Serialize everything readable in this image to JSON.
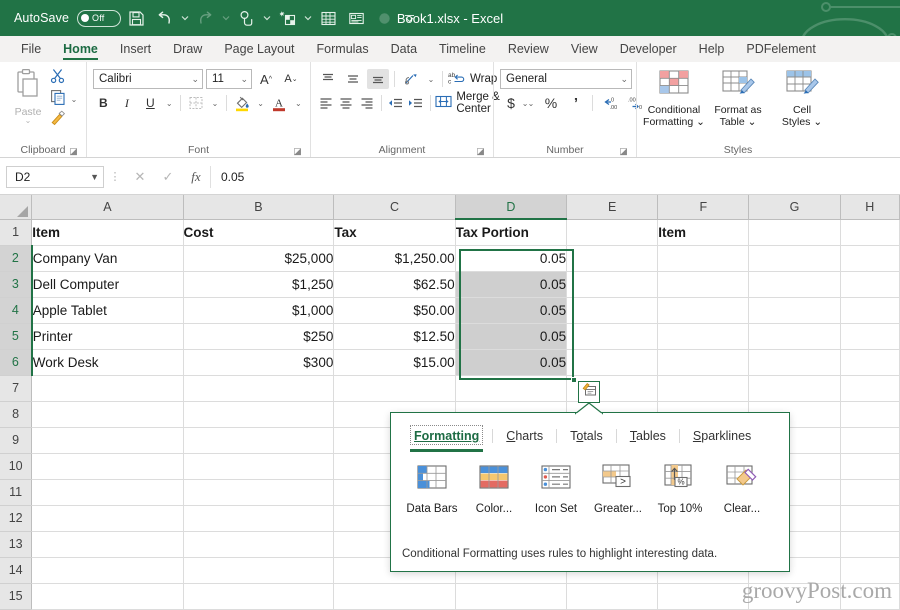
{
  "titlebar": {
    "autosave_label": "AutoSave",
    "autosave_state": "Off",
    "document_title": "Book1.xlsx  -  Excel",
    "quick_access": [
      {
        "name": "save-icon",
        "tooltip": "Save"
      },
      {
        "name": "undo-icon",
        "tooltip": "Undo"
      },
      {
        "name": "redo-icon",
        "tooltip": "Redo"
      },
      {
        "name": "touch-mode-icon",
        "tooltip": "Touch/Mouse Mode"
      },
      {
        "name": "new-sheet-icon",
        "tooltip": "Insert Sheet"
      },
      {
        "name": "table-icon",
        "tooltip": "Table"
      },
      {
        "name": "form-icon",
        "tooltip": "Form"
      },
      {
        "name": "record-icon",
        "tooltip": "Record Macro"
      },
      {
        "name": "customize-caret-icon",
        "tooltip": "Customize Quick Access Toolbar"
      }
    ]
  },
  "ribbon_tabs": [
    {
      "label": "File",
      "active": false
    },
    {
      "label": "Home",
      "active": true
    },
    {
      "label": "Insert",
      "active": false
    },
    {
      "label": "Draw",
      "active": false
    },
    {
      "label": "Page Layout",
      "active": false
    },
    {
      "label": "Formulas",
      "active": false
    },
    {
      "label": "Data",
      "active": false
    },
    {
      "label": "Timeline",
      "active": false
    },
    {
      "label": "Review",
      "active": false
    },
    {
      "label": "View",
      "active": false
    },
    {
      "label": "Developer",
      "active": false
    },
    {
      "label": "Help",
      "active": false
    },
    {
      "label": "PDFelement",
      "active": false
    }
  ],
  "ribbon": {
    "clipboard": {
      "group_label": "Clipboard",
      "paste_label": "Paste",
      "cut_label": "Cut",
      "copy_label": "Copy",
      "format_painter_label": "Format Painter"
    },
    "font": {
      "group_label": "Font",
      "font_name": "Calibri",
      "font_size": "11",
      "grow_font_label": "A",
      "shrink_font_label": "A",
      "bold_label": "B",
      "italic_label": "I",
      "underline_label": "U"
    },
    "alignment": {
      "group_label": "Alignment",
      "wrap_text_label": "Wrap Text",
      "merge_center_label": "Merge & Center"
    },
    "number": {
      "group_label": "Number",
      "format": "General",
      "currency_label": "$",
      "percent_label": "%",
      "comma_label": "’",
      "decrease_decimal_label": ".00",
      "increase_decimal_label": ".00"
    },
    "styles": {
      "group_label": "Styles",
      "buttons": [
        {
          "line1": "Conditional",
          "line2": "Formatting ⌄",
          "icon": "conditional-formatting-icon"
        },
        {
          "line1": "Format as",
          "line2": "Table ⌄",
          "icon": "format-as-table-icon"
        },
        {
          "line1": "Cell",
          "line2": "Styles ⌄",
          "icon": "cell-styles-icon"
        }
      ]
    }
  },
  "formula_bar": {
    "name_box": "D2",
    "cancel_label": "✕",
    "enter_label": "✓",
    "function_label": "fx",
    "formula_value": "0.05"
  },
  "sheet": {
    "columns": [
      "A",
      "B",
      "C",
      "D",
      "E",
      "F",
      "G",
      "H"
    ],
    "selected_column": "D",
    "rows": [
      "1",
      "2",
      "3",
      "4",
      "5",
      "6",
      "7",
      "8",
      "9",
      "10",
      "11",
      "12",
      "13",
      "14",
      "15"
    ],
    "selected_rows": [
      "2",
      "3",
      "4",
      "5",
      "6"
    ],
    "data": [
      {
        "row": "1",
        "A": "Item",
        "B": "Cost",
        "C": "Tax",
        "D": "Tax Portion",
        "E": "",
        "F": "Item",
        "G": "",
        "H": "",
        "bold": true
      },
      {
        "row": "2",
        "A": "Company Van",
        "B": "$25,000",
        "C": "$1,250.00",
        "D": "0.05",
        "E": "",
        "F": "",
        "G": "",
        "H": "",
        "bold": false
      },
      {
        "row": "3",
        "A": "Dell Computer",
        "B": "$1,250",
        "C": "$62.50",
        "D": "0.05",
        "E": "",
        "F": "",
        "G": "",
        "H": "",
        "bold": false
      },
      {
        "row": "4",
        "A": "Apple Tablet",
        "B": "$1,000",
        "C": "$50.00",
        "D": "0.05",
        "E": "",
        "F": "",
        "G": "",
        "H": "",
        "bold": false
      },
      {
        "row": "5",
        "A": "Printer",
        "B": "$250",
        "C": "$12.50",
        "D": "0.05",
        "E": "",
        "F": "",
        "G": "",
        "H": "",
        "bold": false
      },
      {
        "row": "6",
        "A": "Work Desk",
        "B": "$300",
        "C": "$15.00",
        "D": "0.05",
        "E": "",
        "F": "",
        "G": "",
        "H": "",
        "bold": false
      },
      {
        "row": "7",
        "A": "",
        "B": "",
        "C": "",
        "D": "",
        "E": "",
        "F": "",
        "G": "",
        "H": "",
        "bold": false
      },
      {
        "row": "8",
        "A": "",
        "B": "",
        "C": "",
        "D": "",
        "E": "",
        "F": "",
        "G": "",
        "H": "",
        "bold": false
      },
      {
        "row": "9",
        "A": "",
        "B": "",
        "C": "",
        "D": "",
        "E": "",
        "F": "",
        "G": "",
        "H": "",
        "bold": false
      },
      {
        "row": "10",
        "A": "",
        "B": "",
        "C": "",
        "D": "",
        "E": "",
        "F": "",
        "G": "",
        "H": "",
        "bold": false
      },
      {
        "row": "11",
        "A": "",
        "B": "",
        "C": "",
        "D": "",
        "E": "",
        "F": "",
        "G": "",
        "H": "",
        "bold": false
      },
      {
        "row": "12",
        "A": "",
        "B": "",
        "C": "",
        "D": "",
        "E": "",
        "F": "",
        "G": "",
        "H": "",
        "bold": false
      },
      {
        "row": "13",
        "A": "",
        "B": "",
        "C": "",
        "D": "",
        "E": "",
        "F": "",
        "G": "",
        "H": "",
        "bold": false
      },
      {
        "row": "14",
        "A": "",
        "B": "",
        "C": "",
        "D": "",
        "E": "",
        "F": "",
        "G": "",
        "H": "",
        "bold": false
      },
      {
        "row": "15",
        "A": "",
        "B": "",
        "C": "",
        "D": "",
        "E": "",
        "F": "",
        "G": "",
        "H": "",
        "bold": false
      }
    ]
  },
  "quick_analysis": {
    "button_icon": "quick-analysis-icon",
    "tabs": [
      {
        "label": "Formatting",
        "accel": "F",
        "active": true
      },
      {
        "label": "Charts",
        "accel": "C",
        "active": false
      },
      {
        "label": "Totals",
        "accel": "o",
        "active": false
      },
      {
        "label": "Tables",
        "accel": "T",
        "active": false
      },
      {
        "label": "Sparklines",
        "accel": "S",
        "active": false
      }
    ],
    "items": [
      {
        "label": "Data Bars",
        "icon": "data-bars-icon"
      },
      {
        "label": "Color...",
        "icon": "color-scale-icon"
      },
      {
        "label": "Icon Set",
        "icon": "icon-set-icon"
      },
      {
        "label": "Greater...",
        "icon": "greater-than-icon"
      },
      {
        "label": "Top 10%",
        "icon": "top-ten-percent-icon"
      },
      {
        "label": "Clear...",
        "icon": "clear-format-icon"
      }
    ],
    "description": "Conditional Formatting uses rules to highlight interesting data."
  },
  "watermark": {
    "text": "groovyPost.com"
  },
  "colors": {
    "excel_green": "#217346",
    "ribbon_bg": "#f3f2f1",
    "selection_shade": "#cfcfcf"
  }
}
